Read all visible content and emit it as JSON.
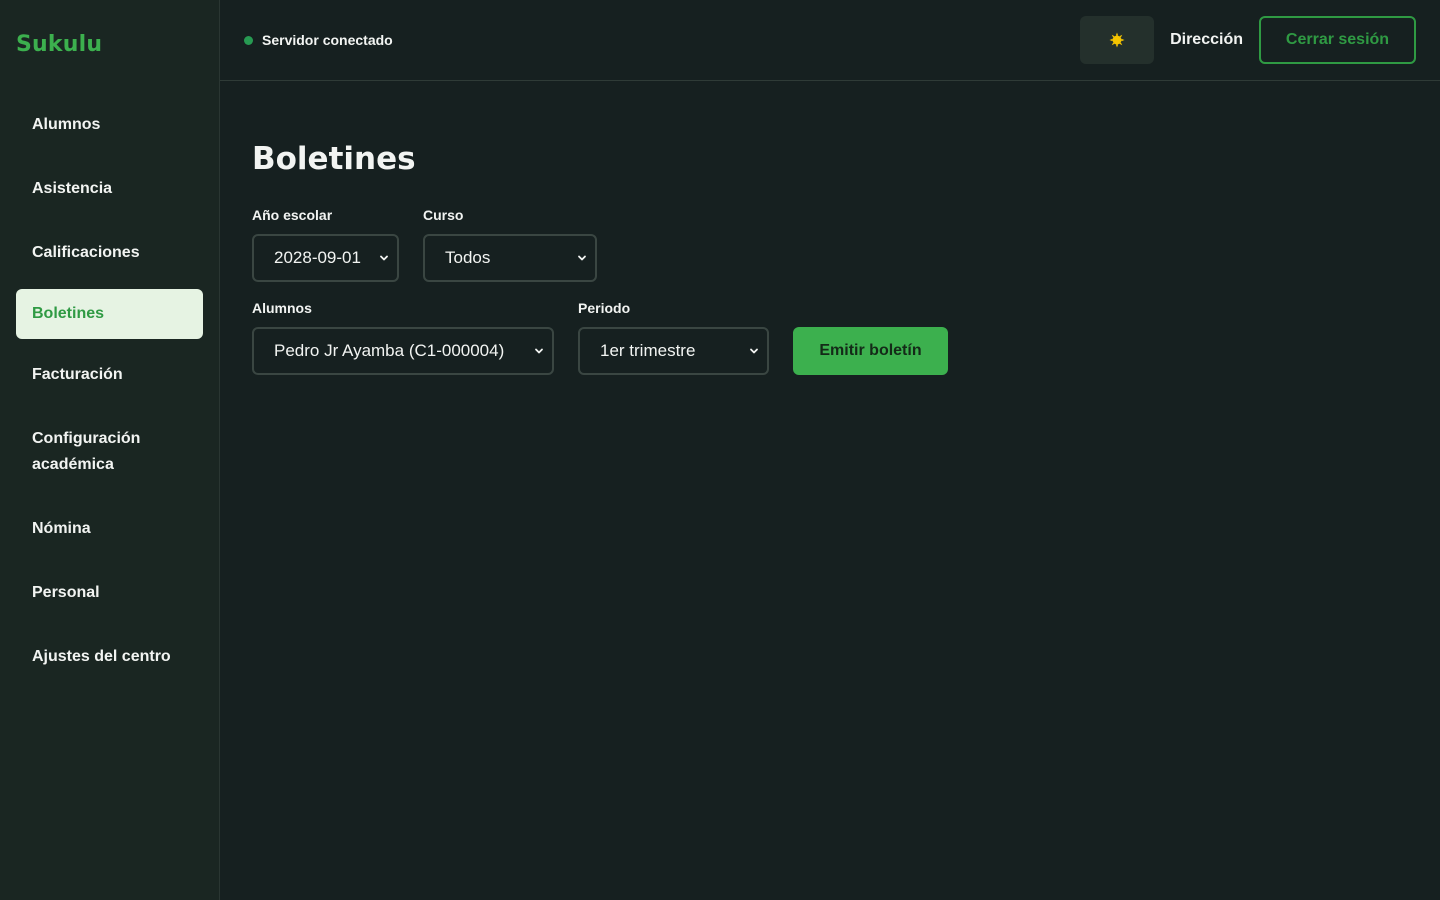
{
  "brand": {
    "name": "Sukulu"
  },
  "colors": {
    "accent": "#3cb04e",
    "accent_dark": "#2f9a43",
    "status_ok": "#279a52",
    "background": "#162020"
  },
  "sidebar": {
    "items": [
      {
        "label": "Alumnos",
        "active": false
      },
      {
        "label": "Asistencia",
        "active": false
      },
      {
        "label": "Calificaciones",
        "active": false
      },
      {
        "label": "Boletines",
        "active": true
      },
      {
        "label": "Facturación",
        "active": false
      },
      {
        "label": "Configuración académica",
        "active": false
      },
      {
        "label": "Nómina",
        "active": false
      },
      {
        "label": "Personal",
        "active": false
      },
      {
        "label": "Ajustes del centro",
        "active": false
      }
    ]
  },
  "header": {
    "status_text": "Servidor conectado",
    "theme_icon": "sun-icon",
    "role": "Dirección",
    "logout_label": "Cerrar sesión"
  },
  "main": {
    "title": "Boletines",
    "filters": {
      "year": {
        "label": "Año escolar",
        "value": "2028-09-01"
      },
      "course": {
        "label": "Curso",
        "value": "Todos"
      },
      "students": {
        "label": "Alumnos",
        "value": "Pedro Jr Ayamba (C1-000004)"
      },
      "period": {
        "label": "Periodo",
        "value": "1er trimestre"
      }
    },
    "emit_label": "Emitir boletín"
  }
}
